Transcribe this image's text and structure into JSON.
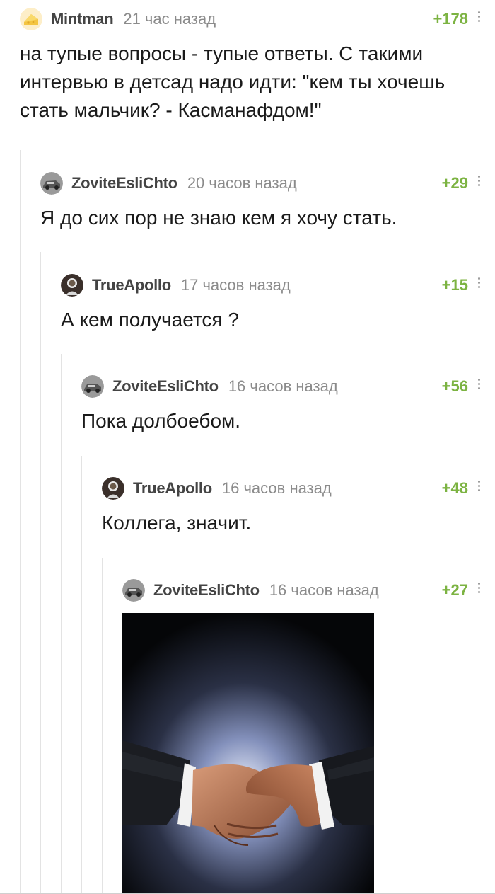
{
  "colors": {
    "rating": "#7cb342",
    "author": "#444444",
    "time": "#8b8b8b",
    "thread_line": "#e3e3e3"
  },
  "comments": [
    {
      "author": "Mintman",
      "time": "21 час назад",
      "rating": "+178",
      "avatar": "cheese-avatar",
      "text": "на тупые вопросы - тупые ответы. С такими интервью в детсад надо идти: \"кем ты хочешь стать мальчик? - Касманафдом!\""
    },
    {
      "author": "ZoviteEsliChto",
      "time": "20 часов назад",
      "rating": "+29",
      "avatar": "car-avatar",
      "text": "Я до сих пор не знаю кем я хочу стать."
    },
    {
      "author": "TrueApollo",
      "time": "17 часов назад",
      "rating": "+15",
      "avatar": "astronaut-avatar",
      "text": "А кем получается ?"
    },
    {
      "author": "ZoviteEsliChto",
      "time": "16 часов назад",
      "rating": "+56",
      "avatar": "car-avatar",
      "text": "Пока долбоебом."
    },
    {
      "author": "TrueApollo",
      "time": "16 часов назад",
      "rating": "+48",
      "avatar": "astronaut-avatar",
      "text": "Коллега, значит."
    },
    {
      "author": "ZoviteEsliChto",
      "time": "16 часов назад",
      "rating": "+27",
      "avatar": "car-avatar",
      "image": "handshake-image"
    }
  ]
}
